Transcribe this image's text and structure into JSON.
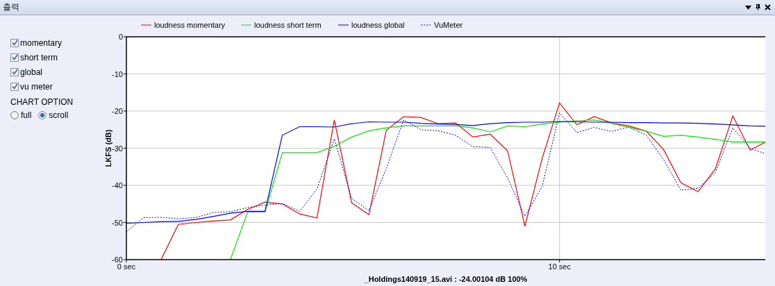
{
  "window": {
    "title": "출력"
  },
  "series_toggles": [
    {
      "label": "momentary",
      "checked": true
    },
    {
      "label": "short term",
      "checked": true
    },
    {
      "label": "global",
      "checked": true
    },
    {
      "label": "vu meter",
      "checked": true
    }
  ],
  "chart_option": {
    "label": "CHART OPTION",
    "options": [
      {
        "label": "full",
        "selected": false
      },
      {
        "label": "scroll",
        "selected": true
      }
    ]
  },
  "chart": {
    "chart_data": {
      "type": "line",
      "xlabel": "_Holdings140919_15.avi : -24.00104 dB 100%",
      "ylabel": "LKFS (dB)",
      "x": [
        0,
        0.4,
        0.8,
        1.2,
        1.6,
        2,
        2.4,
        2.8,
        3.2,
        3.6,
        4,
        4.4,
        4.8,
        5.2,
        5.6,
        6,
        6.4,
        6.8,
        7.2,
        7.6,
        8,
        8.4,
        8.8,
        9.2,
        9.6,
        10,
        10.4,
        10.8,
        11.2,
        11.6,
        12,
        12.4,
        12.8,
        13.2,
        13.6,
        14,
        14.4,
        14.75
      ],
      "series": [
        {
          "name": "loudness momentary",
          "color": "#ff0000",
          "line_style": "solid",
          "values": [
            null,
            null,
            -60,
            -50.5,
            -50,
            -49.6,
            -49.3,
            -46.5,
            -44.5,
            -45,
            -47.7,
            -48.8,
            -22.4,
            -44.7,
            -47.9,
            -25.2,
            -21.5,
            -21.7,
            -23.4,
            -23.2,
            -27,
            -26.2,
            -30.7,
            -51,
            -32.7,
            -17.8,
            -23.7,
            -21.5,
            -23.2,
            -24,
            -25.4,
            -30.3,
            -39.3,
            -41.7,
            -35.5,
            -21.3,
            -30.5,
            -28.4
          ]
        },
        {
          "name": "loudness short term",
          "color": "#00ee00",
          "line_style": "solid",
          "values": [
            null,
            null,
            null,
            null,
            null,
            null,
            -60,
            -47.2,
            -47.2,
            -31.2,
            -31.2,
            -31.2,
            -29.5,
            -27,
            -25.3,
            -24.5,
            -24,
            -24,
            -24,
            -24,
            -24.5,
            -25.6,
            -24,
            -24.2,
            -23.5,
            -23,
            -22.6,
            -22.4,
            -23.3,
            -24.4,
            -25.4,
            -26.8,
            -26.5,
            -27,
            -27.6,
            -28.3,
            -28.3,
            -28.3
          ]
        },
        {
          "name": "loudness global",
          "color": "#0000ff",
          "line_style": "solid",
          "values": [
            -50.2,
            -50,
            -49.8,
            -49.7,
            -49.2,
            -48.4,
            -47.5,
            -47,
            -47,
            -26.5,
            -24.2,
            -24.2,
            -24.3,
            -23.4,
            -22.9,
            -23,
            -23,
            -23.3,
            -23.5,
            -23.6,
            -23.9,
            -23.4,
            -23.1,
            -23,
            -23,
            -22.8,
            -22.9,
            -23,
            -23,
            -23.1,
            -23.1,
            -23.2,
            -23.2,
            -23.3,
            -23.5,
            -23.7,
            -24,
            -24.1
          ]
        },
        {
          "name": "VuMeter",
          "color": "#0000ff",
          "line_style": "dotted",
          "values": [
            -52.5,
            -48.7,
            -48.6,
            -49,
            -48.7,
            -47.3,
            -47.1,
            -46,
            -45.3,
            -44.9,
            -47,
            -41,
            -27.5,
            -43.5,
            -46.8,
            -35.5,
            -22.4,
            -25,
            -25.3,
            -26.5,
            -29.6,
            -29.8,
            -38,
            -48.3,
            -40.3,
            -20.5,
            -25.8,
            -24.4,
            -25.5,
            -24.3,
            -26.5,
            -33,
            -41.3,
            -40.8,
            -36.5,
            -24.5,
            -30,
            -31.5
          ]
        }
      ],
      "grid": true,
      "legend": true,
      "xlim": [
        0,
        14.75
      ],
      "ylim": [
        -60,
        0
      ],
      "xticks": [
        {
          "value": 0,
          "label": "0 sec"
        },
        {
          "value": 10,
          "label": "10 sec"
        }
      ],
      "yticks": [
        -60,
        -50,
        -40,
        -30,
        -20,
        -10,
        0
      ]
    }
  }
}
